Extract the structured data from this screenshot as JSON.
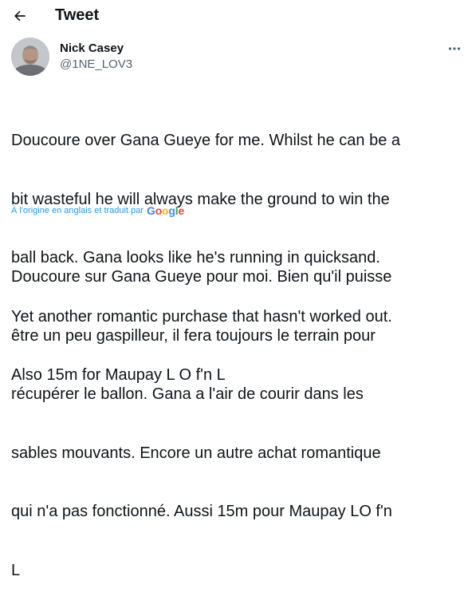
{
  "header": {
    "title": "Tweet",
    "back_icon": "arrow-left-icon"
  },
  "author": {
    "name": "Nick Casey",
    "handle": "@1NE_LOV3",
    "avatar_icon": "avatar"
  },
  "more_icon": "more-dots-icon",
  "tweet": {
    "original_lines": [
      "Doucoure over Gana Gueye for me. Whilst he can be a",
      "bit wasteful he will always make the ground to win the",
      "ball back. Gana looks like he's running in quicksand.",
      "Yet another romantic purchase that hasn't worked out.",
      "Also 15m for Maupay L O f'n L"
    ],
    "translation_note": "À l'origine en anglais et traduit par",
    "translation_provider": "Google",
    "translated_lines": [
      "Doucoure sur Gana Gueye pour moi. Bien qu'il puisse",
      "être un peu gaspilleur, il fera toujours le terrain pour",
      "récupérer le ballon. Gana a l'air de courir dans les",
      "sables mouvants. Encore un autre achat romantique",
      "qui n'a pas fonctionné. Aussi 15m pour Maupay LO f'n",
      "L"
    ]
  },
  "colors": {
    "text": "#0f1419",
    "secondary": "#536471",
    "link": "#1d9bf0"
  }
}
